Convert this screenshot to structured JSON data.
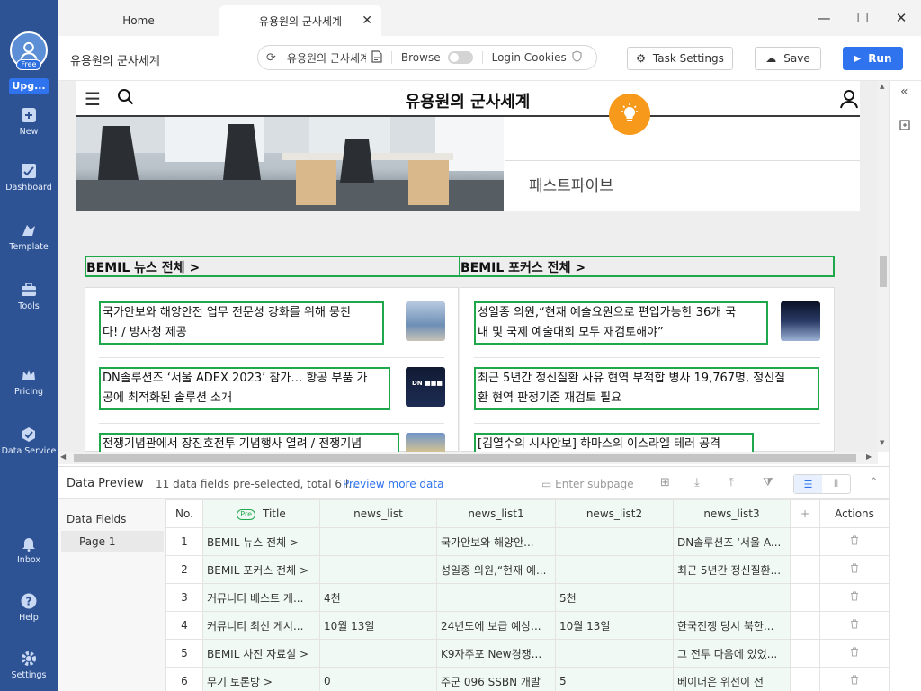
{
  "sidebar": {
    "free_label": "Free",
    "upgrade_label": "Upg...",
    "items": [
      {
        "label": "New",
        "icon": "plus-square-icon"
      },
      {
        "label": "Dashboard",
        "icon": "dashboard-icon"
      },
      {
        "label": "Template",
        "icon": "template-icon"
      },
      {
        "label": "Tools",
        "icon": "toolbox-icon"
      },
      {
        "label": "Pricing",
        "icon": "crown-icon"
      },
      {
        "label": "Data Service",
        "icon": "data-service-icon"
      },
      {
        "label": "Inbox",
        "icon": "bell-icon"
      },
      {
        "label": "Help",
        "icon": "help-icon"
      },
      {
        "label": "Settings",
        "icon": "gear-icon"
      }
    ]
  },
  "tabs": {
    "home": "Home",
    "active": "유용원의 군사세계",
    "close": "✕"
  },
  "window": {
    "minimize": "—",
    "maximize": "☐",
    "close": "✕"
  },
  "toolbar": {
    "page_name": "유용원의 군사세계",
    "url": "유용원의 군사세계",
    "browse_label": "Browse",
    "login_cookies_label": "Login Cookies",
    "task_settings_label": "Task Settings",
    "save_label": "Save",
    "run_label": "Run"
  },
  "website": {
    "title": "유용원의 군사세계",
    "pastpiv": "패스트파이브",
    "sections": [
      {
        "heading": "BEMIL 뉴스 전체 >",
        "items": [
          {
            "line1": "국가안보와 해양안전 업무 전문성 강화를 위해 뭉친",
            "line2": "다! / 방사청 제공"
          },
          {
            "line1": "DN솔루션즈 ‘서울 ADEX 2023’ 참가… 항공 부품 가",
            "line2": "공에 최적화된 솔루션 소개"
          },
          {
            "line1": "전쟁기념관에서 장진호전투 기념행사 열려 / 전쟁기념",
            "line2": ""
          }
        ]
      },
      {
        "heading": "BEMIL 포커스 전체 >",
        "items": [
          {
            "line1": "성일종 의원,“현재 예술요원으로 편입가능한 36개 국",
            "line2": "내 및 국제 예술대회 모두 재검토해야”"
          },
          {
            "line1": "최근 5년간 정신질환 사유 현역 부적합 병사 19,767명, 정신질",
            "line2": "환 현역 판정기준 재검토 필요"
          },
          {
            "line1": "[김열수의 시사안보] 하마스의 이스라엘 테러 공격",
            "line2": ""
          }
        ]
      }
    ]
  },
  "data_preview": {
    "title": "Data Preview",
    "info": "11 data fields pre-selected, total 6 l...",
    "preview_more": "Preview more data",
    "subpage_placeholder": "Enter subpage",
    "fields_label": "Data Fields",
    "page_label": "Page 1",
    "pre_badge": "Pre",
    "columns": [
      "No.",
      "Title",
      "news_list",
      "news_list1",
      "news_list2",
      "news_list3",
      "+",
      "Actions"
    ],
    "rows": [
      {
        "no": "1",
        "title": "BEMIL 뉴스 전체 >",
        "c1": "",
        "c2": "국가안보와 해양안...",
        "c3": "",
        "c4": "DN솔루션즈 ‘서울 A..."
      },
      {
        "no": "2",
        "title": "BEMIL 포커스 전체 >",
        "c1": "",
        "c2": "성일종 의원,“현재 예...",
        "c3": "",
        "c4": "최근 5년간 정신질환..."
      },
      {
        "no": "3",
        "title": "커뮤니티 베스트 게...",
        "c1": "4천",
        "c2": "",
        "c3": "5천",
        "c4": ""
      },
      {
        "no": "4",
        "title": "커뮤니티 최신 게시...",
        "c1": "10월 13일",
        "c2": "24년도에 보급 예상...",
        "c3": "10월 13일",
        "c4": "한국전쟁 당시 북한..."
      },
      {
        "no": "5",
        "title": "BEMIL 사진 자료실 >",
        "c1": "",
        "c2": "K9자주포 New경쟁...",
        "c3": "",
        "c4": "그 전투 다음에 있었..."
      },
      {
        "no": "6",
        "title": "무기 토론방 >",
        "c1": "0",
        "c2": "주군 096 SSBN 개발",
        "c3": "5",
        "c4": "베이더은 위선이 전"
      }
    ]
  }
}
